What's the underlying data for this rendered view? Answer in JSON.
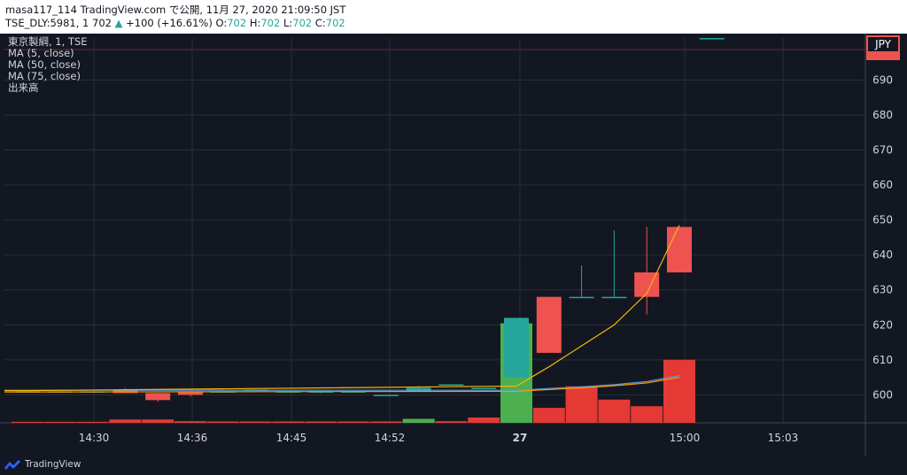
{
  "header": {
    "line1": "masa117_114 TradingView.com で公開, 11月 27, 2020 21:09:50 JST",
    "symbol": "TSE_DLY:5981, 1 702",
    "arrow": "▲",
    "change": "+100 (+16.61%)",
    "o_label": "O:",
    "o_val": "702",
    "h_label": "H:",
    "h_val": "702",
    "l_label": "L:",
    "l_val": "702",
    "c_label": "C:",
    "c_val": "702"
  },
  "legend": {
    "title": "東京製綱, 1, TSE",
    "ma5": "MA (5, close)",
    "ma50": "MA (50, close)",
    "ma75": "MA (75, close)",
    "volume": "出来高"
  },
  "currency": "JPY",
  "brand": "TradingView",
  "colors": {
    "background": "#131722",
    "grid": "#2a2e39",
    "up": "#26a69a",
    "down": "#ef5350",
    "vol_up": "#4caf50",
    "vol_down": "#e53935",
    "ma5": "#f0b90b",
    "ma50": "#5b9bd5",
    "ma75": "#ff9800"
  },
  "chart_data": {
    "type": "candlestick",
    "ylim": [
      592,
      702
    ],
    "y_ticks": [
      600,
      610,
      620,
      630,
      640,
      650,
      660,
      670,
      680,
      690
    ],
    "x_tick_labels": [
      "14:30",
      "14:36",
      "14:45",
      "14:52",
      "27",
      "15:00",
      "15:03"
    ],
    "candles": [
      {
        "o": 601,
        "h": 601,
        "l": 601,
        "c": 601
      },
      {
        "o": 601,
        "h": 601,
        "l": 601,
        "c": 601
      },
      {
        "o": 601,
        "h": 601,
        "l": 601,
        "c": 601
      },
      {
        "o": 601.5,
        "h": 602,
        "l": 600.5,
        "c": 600.5
      },
      {
        "o": 600.5,
        "h": 600.5,
        "l": 598,
        "c": 598.5
      },
      {
        "o": 601,
        "h": 601,
        "l": 599.5,
        "c": 600
      },
      {
        "o": 601,
        "h": 601,
        "l": 601,
        "c": 601
      },
      {
        "o": 601.5,
        "h": 601.5,
        "l": 601.5,
        "c": 601.5
      },
      {
        "o": 601,
        "h": 601,
        "l": 601,
        "c": 601
      },
      {
        "o": 601,
        "h": 601,
        "l": 600.5,
        "c": 601
      },
      {
        "o": 601,
        "h": 601,
        "l": 601,
        "c": 601
      },
      {
        "o": 600,
        "h": 600,
        "l": 600,
        "c": 600
      },
      {
        "o": 601,
        "h": 602.5,
        "l": 601,
        "c": 602
      },
      {
        "o": 603,
        "h": 603,
        "l": 603,
        "c": 603
      },
      {
        "o": 602,
        "h": 602,
        "l": 602,
        "c": 602
      },
      {
        "o": 605,
        "h": 622,
        "l": 605,
        "c": 622
      },
      {
        "o": 628,
        "h": 628,
        "l": 612,
        "c": 612
      },
      {
        "o": 628,
        "h": 637,
        "l": 628,
        "c": 628
      },
      {
        "o": 628,
        "h": 647,
        "l": 628,
        "c": 628
      },
      {
        "o": 635,
        "h": 648,
        "l": 623,
        "c": 628
      },
      {
        "o": 648,
        "h": 648,
        "l": 635,
        "c": 635
      },
      {
        "o": 702,
        "h": 702,
        "l": 702,
        "c": 702
      }
    ],
    "volume": [
      {
        "v": 0.3,
        "up": false
      },
      {
        "v": 0.3,
        "up": false
      },
      {
        "v": 0.3,
        "up": false
      },
      {
        "v": 1.0,
        "up": false
      },
      {
        "v": 1.0,
        "up": false
      },
      {
        "v": 0.5,
        "up": false
      },
      {
        "v": 0.4,
        "up": false
      },
      {
        "v": 0.4,
        "up": false
      },
      {
        "v": 0.4,
        "up": false
      },
      {
        "v": 0.4,
        "up": false
      },
      {
        "v": 0.4,
        "up": false
      },
      {
        "v": 0.4,
        "up": false
      },
      {
        "v": 1.2,
        "up": true
      },
      {
        "v": 0.5,
        "up": false
      },
      {
        "v": 1.6,
        "up": false
      },
      {
        "v": 30,
        "up": true
      },
      {
        "v": 4.5,
        "up": false
      },
      {
        "v": 11,
        "up": false
      },
      {
        "v": 7,
        "up": false
      },
      {
        "v": 5,
        "up": false
      },
      {
        "v": 19,
        "up": false
      },
      {
        "v": 0,
        "up": false
      }
    ],
    "ma5": [
      {
        "i": 0,
        "y": 601.2
      },
      {
        "i": 15,
        "y": 602.5
      },
      {
        "i": 16,
        "y": 608
      },
      {
        "i": 17,
        "y": 614
      },
      {
        "i": 18,
        "y": 620
      },
      {
        "i": 19,
        "y": 629
      },
      {
        "i": 20,
        "y": 648.5
      }
    ],
    "ma50": [
      {
        "i": 0,
        "y": 601.3
      },
      {
        "i": 15,
        "y": 601.3
      },
      {
        "i": 16,
        "y": 601.8
      },
      {
        "i": 17,
        "y": 602.3
      },
      {
        "i": 18,
        "y": 602.9
      },
      {
        "i": 19,
        "y": 603.8
      },
      {
        "i": 20,
        "y": 605.5
      }
    ],
    "ma75": [
      {
        "i": 0,
        "y": 600.8
      },
      {
        "i": 15,
        "y": 601.0
      },
      {
        "i": 16,
        "y": 601.5
      },
      {
        "i": 17,
        "y": 602.0
      },
      {
        "i": 18,
        "y": 602.6
      },
      {
        "i": 19,
        "y": 603.4
      },
      {
        "i": 20,
        "y": 605.0
      }
    ]
  }
}
